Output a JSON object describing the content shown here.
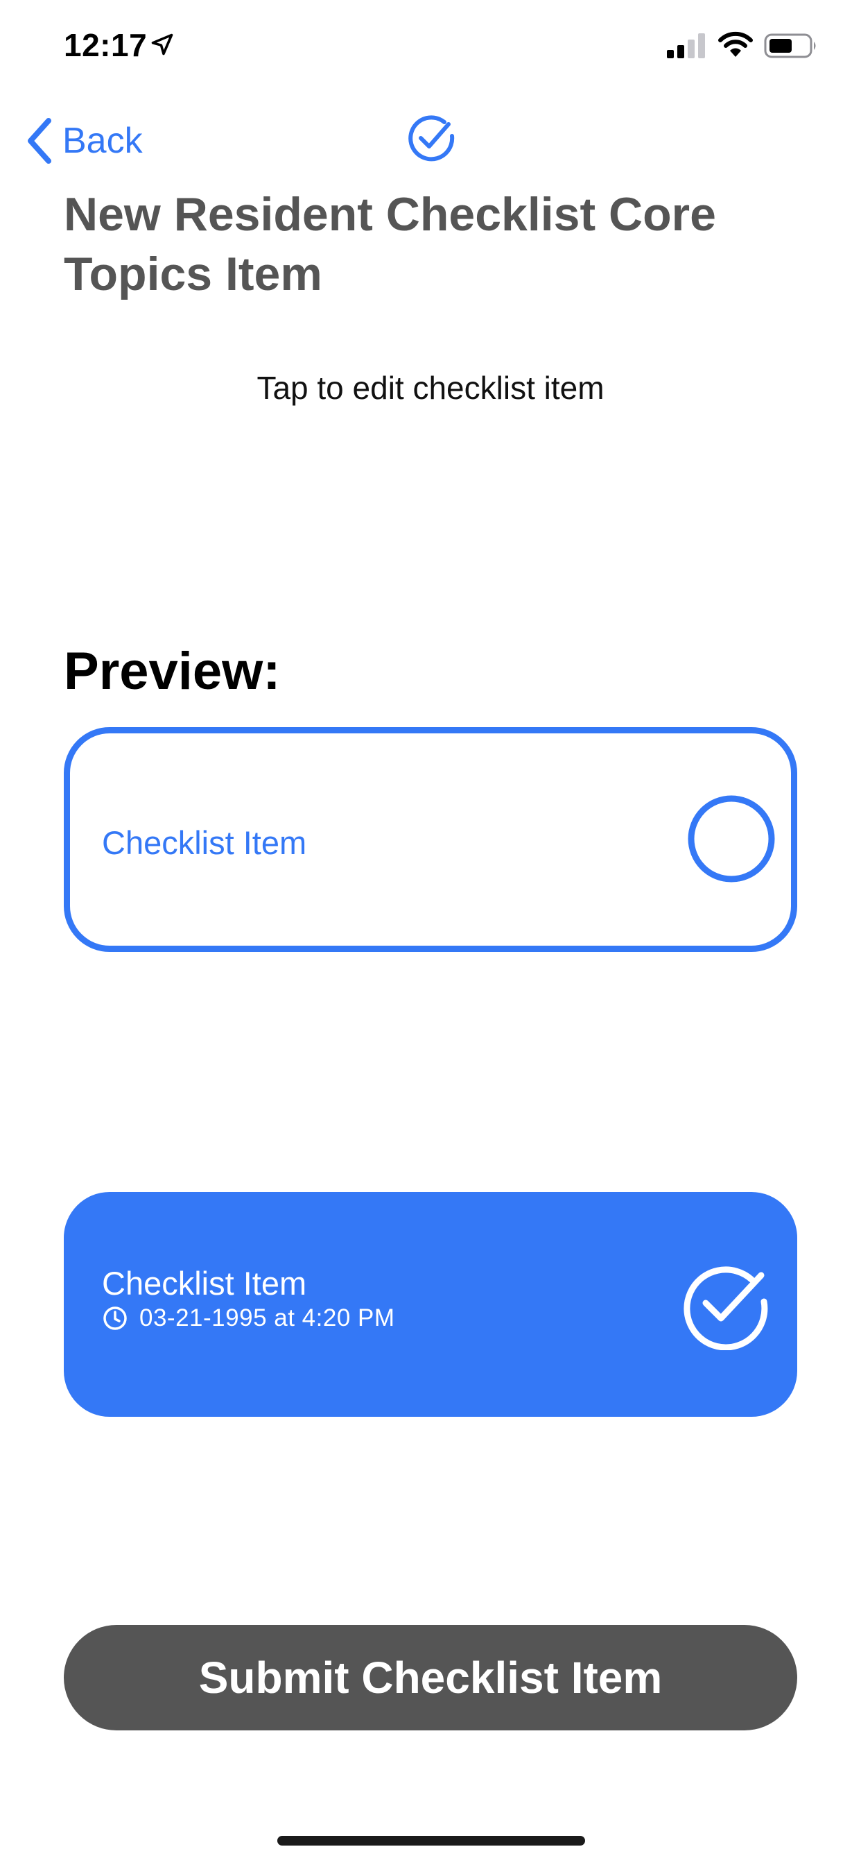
{
  "status_bar": {
    "time": "12:17",
    "icons": [
      "location-arrow-icon",
      "cellular-signal-icon",
      "wifi-icon",
      "battery-icon"
    ]
  },
  "nav": {
    "back_label": "Back",
    "center_icon": "checkmark-circle-icon"
  },
  "page_title": "New Resident Checklist Core Topics Item",
  "edit_prompt": "Tap to edit checklist item",
  "preview": {
    "heading": "Preview:",
    "unchecked_card": {
      "label": "Checklist Item",
      "icon": "empty-circle-icon"
    },
    "checked_card": {
      "label": "Checklist Item",
      "timestamp": "03-21-1995 at 4:20 PM",
      "icons": [
        "clock-icon",
        "checkmark-circle-icon"
      ]
    }
  },
  "submit_label": "Submit Checklist Item",
  "colors": {
    "accent": "#3478f6",
    "title_gray": "#555555",
    "button_gray": "#555555",
    "background": "#ffffff"
  }
}
